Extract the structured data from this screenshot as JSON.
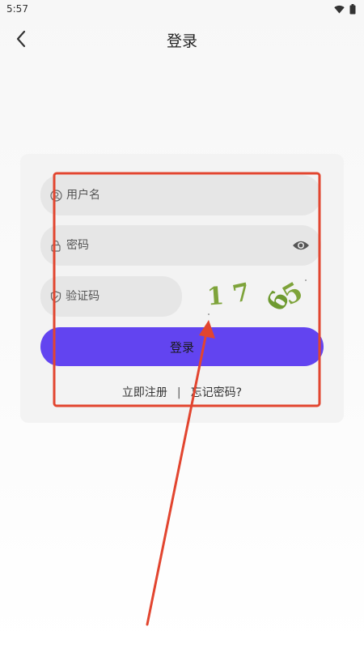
{
  "status_bar": {
    "time": "5:57",
    "wifi_icon": "wifi-icon",
    "battery_icon": "battery-icon"
  },
  "header": {
    "title": "登录",
    "back_icon": "chevron-left-icon"
  },
  "form": {
    "username": {
      "placeholder": "用户名",
      "value": "",
      "icon": "user-circle-icon"
    },
    "password": {
      "placeholder": "密码",
      "value": "",
      "icon": "lock-icon",
      "toggle_icon": "eye-icon"
    },
    "captcha_input": {
      "placeholder": "验证码",
      "value": "",
      "icon": "shield-icon"
    },
    "captcha_image": {
      "chars": [
        "1",
        "7",
        "6",
        "5"
      ],
      "color": "#7ea33a"
    },
    "login_label": "登录"
  },
  "links": {
    "register": "立即注册",
    "separator": "|",
    "forgot": "忘记密码?"
  },
  "colors": {
    "accent": "#6244f0",
    "annotation": "#e2452f",
    "card_bg": "#f3f3f3",
    "field_bg": "#e6e6e6"
  }
}
